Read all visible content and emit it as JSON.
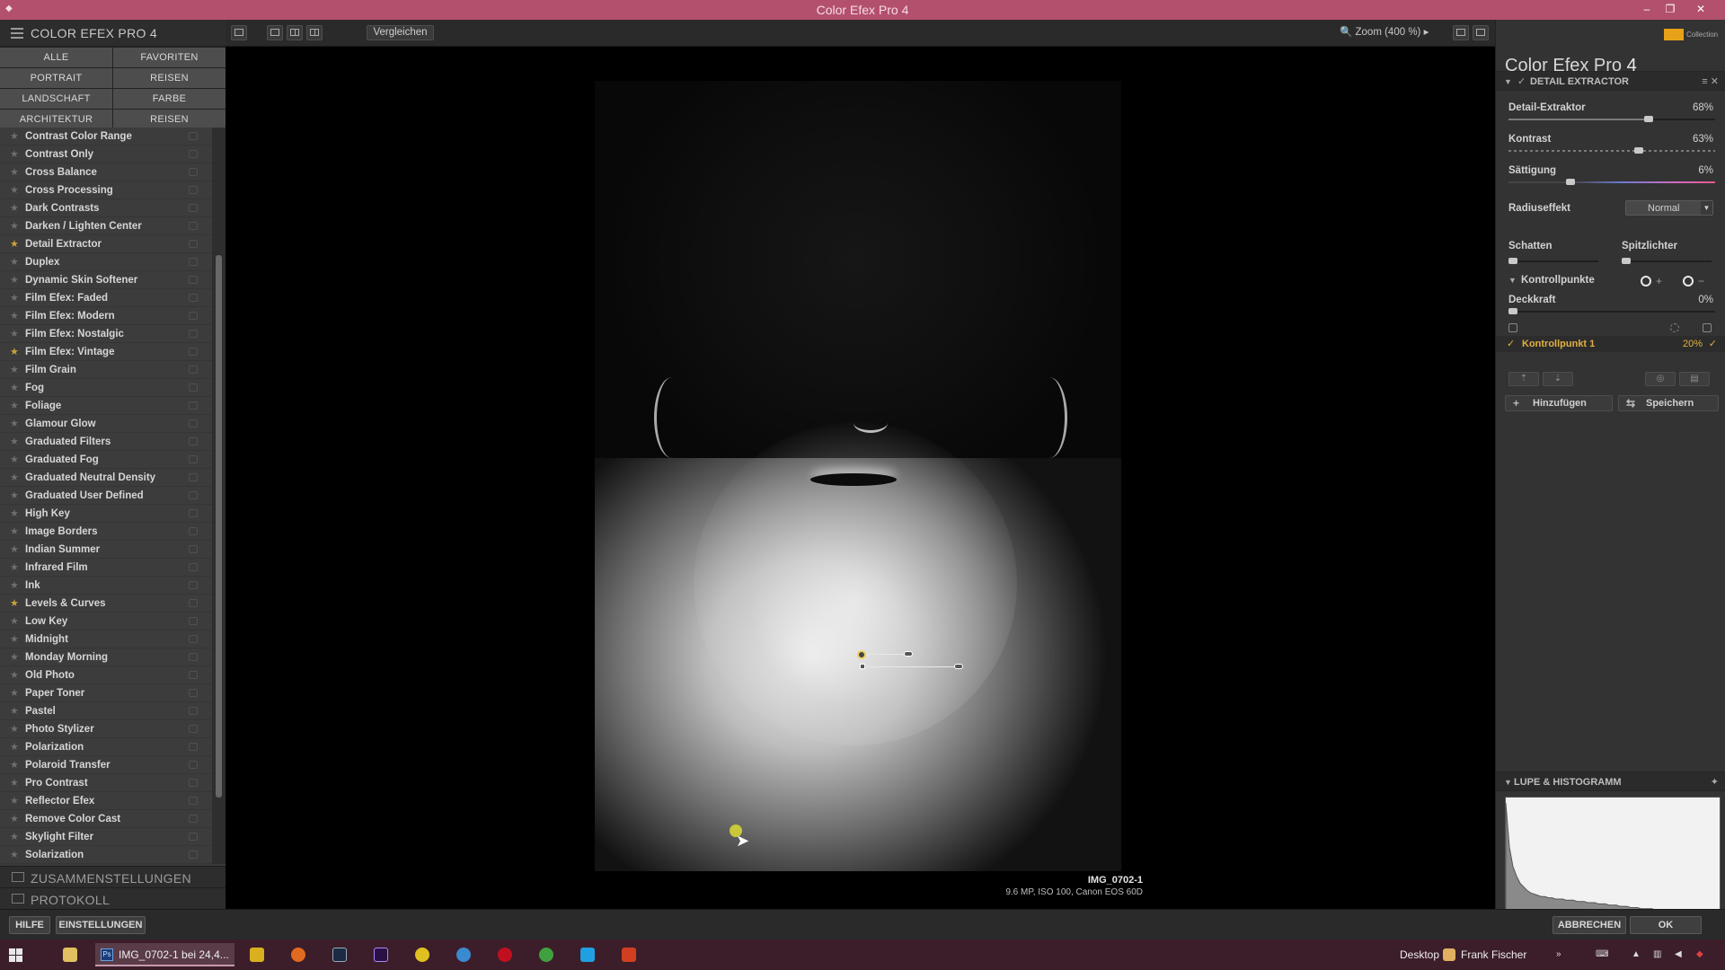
{
  "window": {
    "title": "Color Efex Pro 4",
    "controls": [
      "–",
      "❐",
      "✕"
    ]
  },
  "left_panel": {
    "header": "COLOR EFEX PRO 4",
    "categories": [
      "ALLE",
      "FAVORITEN",
      "PORTRAIT",
      "REISEN",
      "LANDSCHAFT",
      "FARBE",
      "ARCHITEKTUR",
      "REISEN"
    ],
    "filters": [
      {
        "name": "Contrast Color Range",
        "favorite": false
      },
      {
        "name": "Contrast Only",
        "favorite": false
      },
      {
        "name": "Cross Balance",
        "favorite": false
      },
      {
        "name": "Cross Processing",
        "favorite": false
      },
      {
        "name": "Dark Contrasts",
        "favorite": false
      },
      {
        "name": "Darken / Lighten Center",
        "favorite": false
      },
      {
        "name": "Detail Extractor",
        "favorite": true
      },
      {
        "name": "Duplex",
        "favorite": false
      },
      {
        "name": "Dynamic Skin Softener",
        "favorite": false
      },
      {
        "name": "Film Efex: Faded",
        "favorite": false
      },
      {
        "name": "Film Efex: Modern",
        "favorite": false
      },
      {
        "name": "Film Efex: Nostalgic",
        "favorite": false
      },
      {
        "name": "Film Efex: Vintage",
        "favorite": true
      },
      {
        "name": "Film Grain",
        "favorite": false
      },
      {
        "name": "Fog",
        "favorite": false
      },
      {
        "name": "Foliage",
        "favorite": false
      },
      {
        "name": "Glamour Glow",
        "favorite": false
      },
      {
        "name": "Graduated Filters",
        "favorite": false
      },
      {
        "name": "Graduated Fog",
        "favorite": false
      },
      {
        "name": "Graduated Neutral Density",
        "favorite": false
      },
      {
        "name": "Graduated User Defined",
        "favorite": false
      },
      {
        "name": "High Key",
        "favorite": false
      },
      {
        "name": "Image Borders",
        "favorite": false
      },
      {
        "name": "Indian Summer",
        "favorite": false
      },
      {
        "name": "Infrared Film",
        "favorite": false
      },
      {
        "name": "Ink",
        "favorite": false
      },
      {
        "name": "Levels & Curves",
        "favorite": true
      },
      {
        "name": "Low Key",
        "favorite": false
      },
      {
        "name": "Midnight",
        "favorite": false
      },
      {
        "name": "Monday Morning",
        "favorite": false
      },
      {
        "name": "Old Photo",
        "favorite": false
      },
      {
        "name": "Paper Toner",
        "favorite": false
      },
      {
        "name": "Pastel",
        "favorite": false
      },
      {
        "name": "Photo Stylizer",
        "favorite": false
      },
      {
        "name": "Polarization",
        "favorite": false
      },
      {
        "name": "Polaroid Transfer",
        "favorite": false
      },
      {
        "name": "Pro Contrast",
        "favorite": false
      },
      {
        "name": "Reflector Efex",
        "favorite": false
      },
      {
        "name": "Remove Color Cast",
        "favorite": false
      },
      {
        "name": "Skylight Filter",
        "favorite": false
      },
      {
        "name": "Solarization",
        "favorite": false
      }
    ],
    "recipes_label": "ZUSAMMENSTELLUNGEN",
    "history_label": "PROTOKOLL"
  },
  "toolbar": {
    "compare_label": "Vergleichen",
    "zoom_label": "Zoom (400 %)"
  },
  "image": {
    "filename": "IMG_0702-1",
    "meta": "9.6 MP, ISO 100, Canon EOS 60D"
  },
  "right_panel": {
    "brand_name": "Color Efex Pro",
    "brand_version": "4",
    "logo_text": "Collection",
    "filter_title": "DETAIL EXTRACTOR",
    "params": {
      "detail": {
        "label": "Detail-Extraktor",
        "value": "68%",
        "level": 0.68
      },
      "contrast": {
        "label": "Kontrast",
        "value": "63%",
        "level": 0.63
      },
      "saturation": {
        "label": "Sättigung",
        "value": "6%",
        "level": 0.3
      }
    },
    "radius_label": "Radiuseffekt",
    "radius_value": "Normal",
    "shadows_label": "Schatten",
    "highlights_label": "Spitzlichter",
    "controlpoints_label": "Kontrollpunkte",
    "opacity_label": "Deckkraft",
    "opacity_value": "0%",
    "controlpoint": {
      "label": "Kontrollpunkt 1",
      "value": "20%"
    },
    "add_label": "Hinzufügen",
    "save_label": "Speichern",
    "loupe_title": "LUPE & HISTOGRAMM",
    "histogram": [
      96,
      60,
      44,
      36,
      30,
      27,
      24,
      22,
      21,
      20,
      19,
      19,
      18,
      18,
      17,
      17,
      17,
      16,
      16,
      16,
      15,
      15,
      15,
      14,
      14,
      14,
      13,
      13,
      13,
      12,
      12,
      12,
      11,
      11,
      11,
      10,
      10,
      10,
      9,
      9,
      9,
      9,
      8,
      8,
      8,
      8,
      7,
      7,
      7,
      7,
      6,
      6,
      6,
      6,
      5,
      5,
      5,
      5,
      5,
      4
    ]
  },
  "bottom": {
    "help_label": "HILFE",
    "settings_label": "EINSTELLUNGEN",
    "cancel_label": "ABBRECHEN",
    "ok_label": "OK"
  },
  "taskbar": {
    "active_app_label": "IMG_0702-1 bei 24,4...",
    "desktop_label": "Desktop",
    "user_label": "Frank Fischer"
  }
}
